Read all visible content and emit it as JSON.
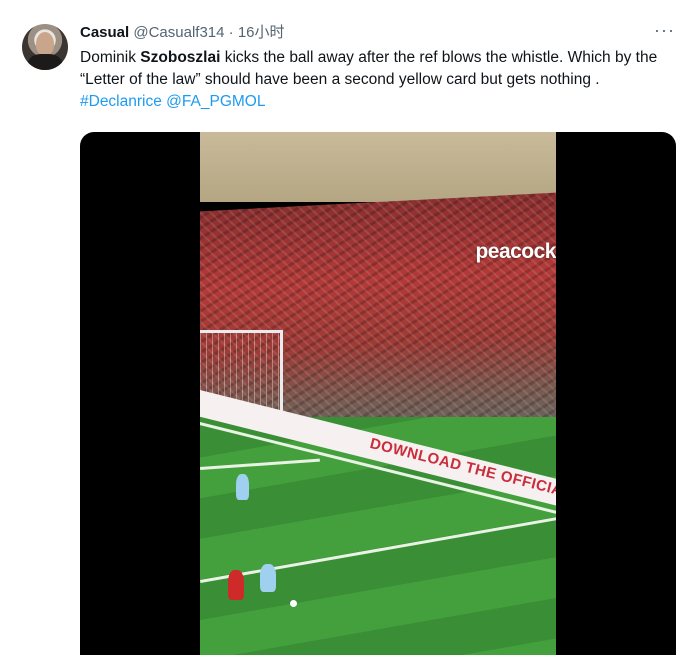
{
  "tweet": {
    "author_name": "Casual",
    "handle": "@Casualf314",
    "separator": "·",
    "time": "16小时",
    "more": "···",
    "text_parts": {
      "p1": "Dominik ",
      "bold": "Szoboszlai",
      "p2": " kicks the ball away after the ref blows the whistle. Which by the “Letter of the law” should have been a second yellow card but gets nothing . ",
      "hashtag": "#Declanrice",
      "space": " ",
      "mention": "@FA_PGMOL"
    }
  },
  "media": {
    "type": "video",
    "overlay_logo": "peacock",
    "board_text": "DOWNLOAD THE OFFICIAL"
  },
  "colors": {
    "link": "#1d9bf0",
    "secondary_text": "#536471",
    "primary_text": "#0f1419"
  }
}
